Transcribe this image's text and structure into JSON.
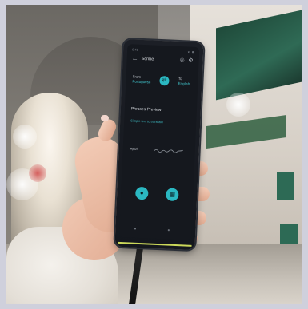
{
  "phone_screen": {
    "status_time": "9:41",
    "status_icons": "▾ ▮",
    "back_icon": "back-arrow-icon",
    "title": "Scribe",
    "mic_icon": "microphone-icon",
    "settings_icon": "gear-icon",
    "lang_from_label": "From",
    "lang_from_value": "Portuguese",
    "lang_to_label": "To",
    "lang_to_value": "English",
    "swap_icon": "swap-icon",
    "section_title": "Phrases Preview",
    "section_text": "Simple text to translate",
    "input_label": "Input",
    "fab_left_icon": "microphone-icon",
    "fab_right_icon": "keyboard-icon",
    "nav_left": "●",
    "nav_right": "●"
  },
  "colors": {
    "accent": "#2bb8c2",
    "strip": "#cbd85a"
  }
}
